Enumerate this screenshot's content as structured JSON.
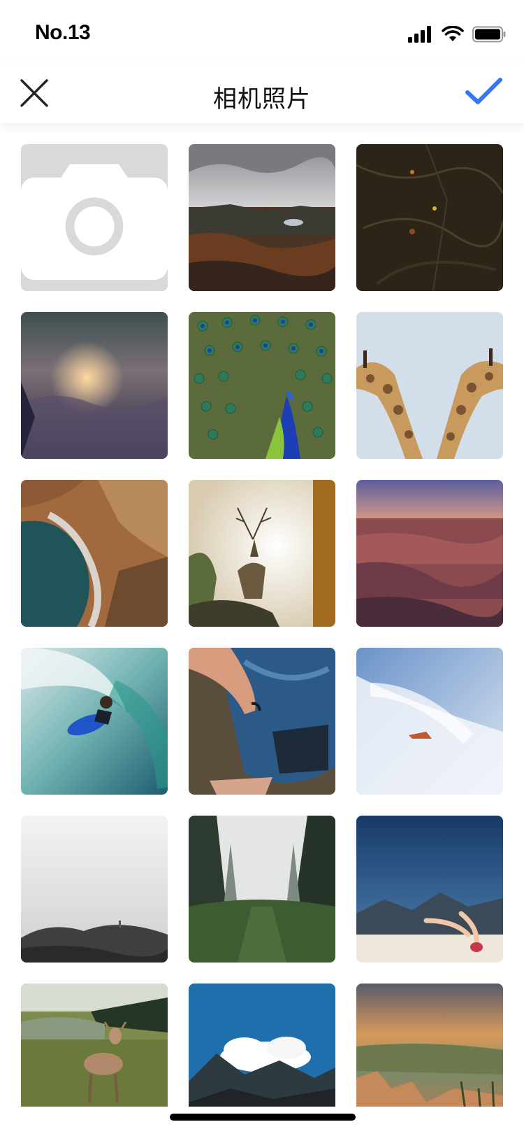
{
  "status_bar": {
    "time": "No.13",
    "icons": [
      "signal-icon",
      "wifi-icon",
      "battery-icon"
    ]
  },
  "nav": {
    "title": "相机照片",
    "close_icon": "close-icon",
    "confirm_icon": "checkmark-icon",
    "accent_color": "#3478f6"
  },
  "grid": {
    "camera_tile_icon": "camera-icon",
    "photos": [
      "landscape-cloudy-moor",
      "dark-forest-floor",
      "sunset-above-clouds",
      "peacock-tail",
      "two-giraffes",
      "coastal-cliffs-aerial",
      "deer-in-woods",
      "grand-canyon",
      "surfer-in-wave",
      "person-in-tie-dye",
      "kite-in-sky",
      "foggy-rocks",
      "misty-forest-path",
      "legs-on-beach",
      "deer-in-meadow",
      "mountain-cloud",
      "canyon-sunset"
    ]
  }
}
